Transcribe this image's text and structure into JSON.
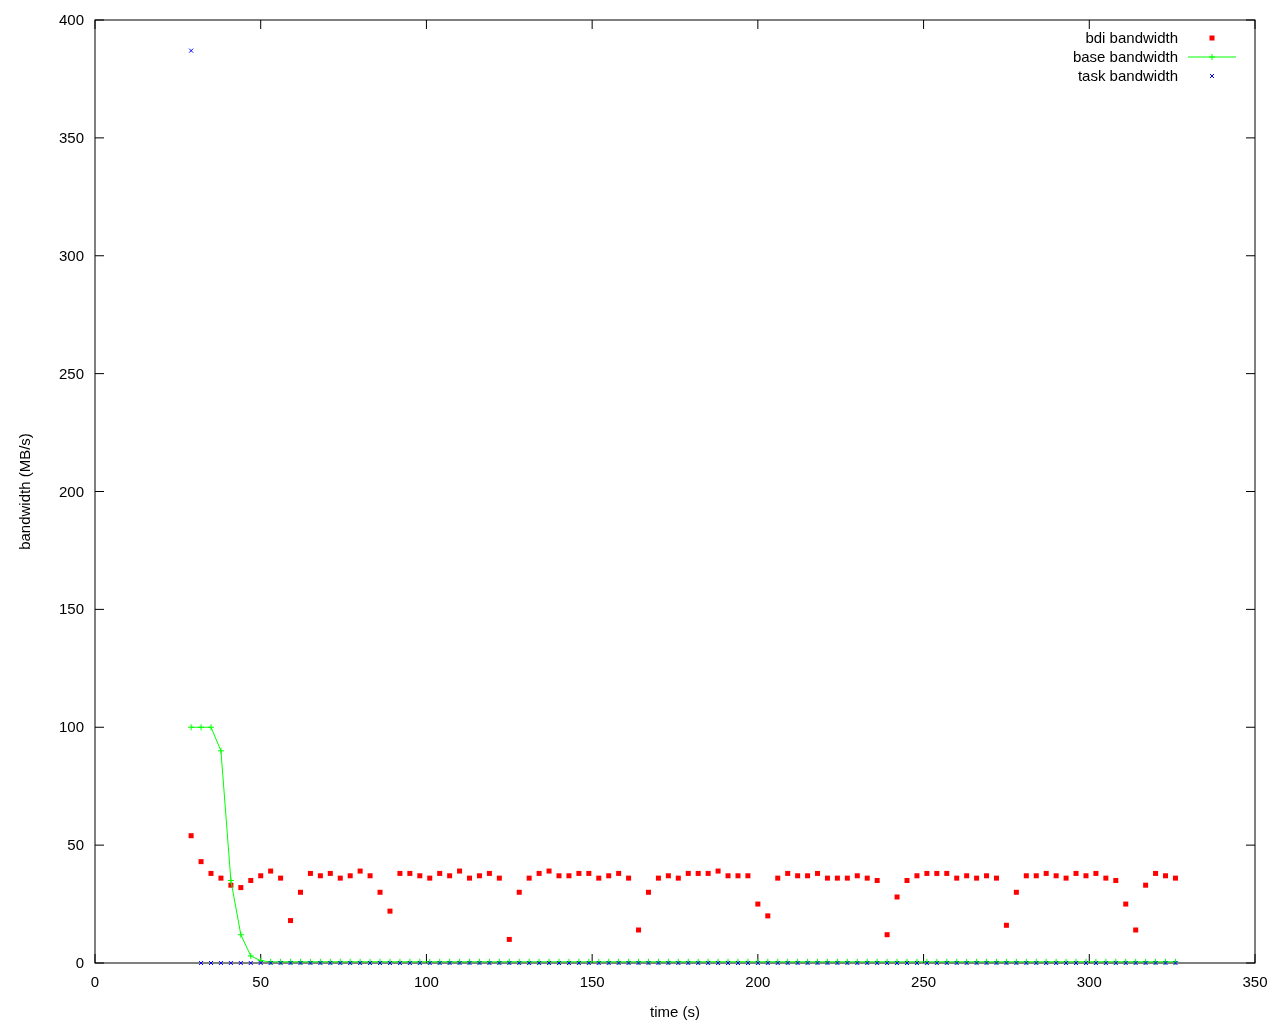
{
  "chart_data": {
    "type": "scatter",
    "xlabel": "time (s)",
    "ylabel": "bandwidth (MB/s)",
    "xlim": [
      0,
      350
    ],
    "ylim": [
      0,
      400
    ],
    "xticks": [
      0,
      50,
      100,
      150,
      200,
      250,
      300,
      350
    ],
    "legend": true,
    "yticks": [
      0,
      50,
      100,
      150,
      200,
      250,
      300,
      350,
      400
    ],
    "x": [
      29,
      32,
      35,
      38,
      41,
      44,
      47,
      50,
      53,
      56,
      59,
      62,
      65,
      68,
      71,
      74,
      77,
      80,
      83,
      86,
      89,
      92,
      95,
      98,
      101,
      104,
      107,
      110,
      113,
      116,
      119,
      122,
      125,
      128,
      131,
      134,
      137,
      140,
      143,
      146,
      149,
      152,
      155,
      158,
      161,
      164,
      167,
      170,
      173,
      176,
      179,
      182,
      185,
      188,
      191,
      194,
      197,
      200,
      203,
      206,
      209,
      212,
      215,
      218,
      221,
      224,
      227,
      230,
      233,
      236,
      239,
      242,
      245,
      248,
      251,
      254,
      257,
      260,
      263,
      266,
      269,
      272,
      275,
      278,
      281,
      284,
      287,
      290,
      293,
      296,
      299,
      302,
      305,
      308,
      311,
      314,
      317,
      320,
      323,
      326
    ],
    "series": [
      {
        "name": "bdi bandwidth",
        "color": "#ff0000",
        "type": "scatter",
        "marker": "square",
        "values": [
          54,
          43,
          38,
          36,
          33,
          32,
          35,
          37,
          39,
          36,
          18,
          30,
          38,
          37,
          38,
          36,
          37,
          39,
          37,
          30,
          22,
          38,
          38,
          37,
          36,
          38,
          37,
          39,
          36,
          37,
          38,
          36,
          10,
          30,
          36,
          38,
          39,
          37,
          37,
          38,
          38,
          36,
          37,
          38,
          36,
          14,
          30,
          36,
          37,
          36,
          38,
          38,
          38,
          39,
          37,
          37,
          37,
          25,
          20,
          36,
          38,
          37,
          37,
          38,
          36,
          36,
          36,
          37,
          36,
          35,
          12,
          28,
          35,
          37,
          38,
          38,
          38,
          36,
          37,
          36,
          37,
          36,
          16,
          30,
          37,
          37,
          38,
          37,
          36,
          38,
          37,
          38,
          36,
          35,
          25,
          14,
          33,
          38,
          37,
          36
        ]
      },
      {
        "name": "base bandwidth",
        "color": "#00ff00",
        "type": "line",
        "marker": "plus",
        "values": [
          100,
          100,
          100,
          90,
          35,
          12,
          3,
          1,
          0.5,
          0.5,
          0.5,
          0.5,
          0.5,
          0.5,
          0.5,
          0.5,
          0.5,
          0.5,
          0.5,
          0.5,
          0.5,
          0.5,
          0.5,
          0.5,
          0.5,
          0.5,
          0.5,
          0.5,
          0.5,
          0.5,
          0.5,
          0.5,
          0.5,
          0.5,
          0.5,
          0.5,
          0.5,
          0.5,
          0.5,
          0.5,
          0.5,
          0.5,
          0.5,
          0.5,
          0.5,
          0.5,
          0.5,
          0.5,
          0.5,
          0.5,
          0.5,
          0.5,
          0.5,
          0.5,
          0.5,
          0.5,
          0.5,
          0.5,
          0.5,
          0.5,
          0.5,
          0.5,
          0.5,
          0.5,
          0.5,
          0.5,
          0.5,
          0.5,
          0.5,
          0.5,
          0.5,
          0.5,
          0.5,
          0.5,
          0.5,
          0.5,
          0.5,
          0.5,
          0.5,
          0.5,
          0.5,
          0.5,
          0.5,
          0.5,
          0.5,
          0.5,
          0.5,
          0.5,
          0.5,
          0.5,
          0.5,
          0.5,
          0.5,
          0.5,
          0.5,
          0.5,
          0.5,
          0.5,
          0.5,
          0.5
        ]
      },
      {
        "name": "task bandwidth",
        "color": "#0000ff",
        "type": "scatter",
        "marker": "cross",
        "values": [
          387,
          0,
          0,
          0,
          0,
          0,
          0,
          0,
          0,
          0,
          0,
          0,
          0,
          0,
          0,
          0,
          0,
          0,
          0,
          0,
          0,
          0,
          0,
          0,
          0,
          0,
          0,
          0,
          0,
          0,
          0,
          0,
          0,
          0,
          0,
          0,
          0,
          0,
          0,
          0,
          0,
          0,
          0,
          0,
          0,
          0,
          0,
          0,
          0,
          0,
          0,
          0,
          0,
          0,
          0,
          0,
          0,
          0,
          0,
          0,
          0,
          0,
          0,
          0,
          0,
          0,
          0,
          0,
          0,
          0,
          0,
          0,
          0,
          0,
          0,
          0,
          0,
          0,
          0,
          0,
          0,
          0,
          0,
          0,
          0,
          0,
          0,
          0,
          0,
          0,
          0,
          0,
          0,
          0,
          0,
          0,
          0,
          0,
          0,
          0
        ]
      }
    ]
  }
}
